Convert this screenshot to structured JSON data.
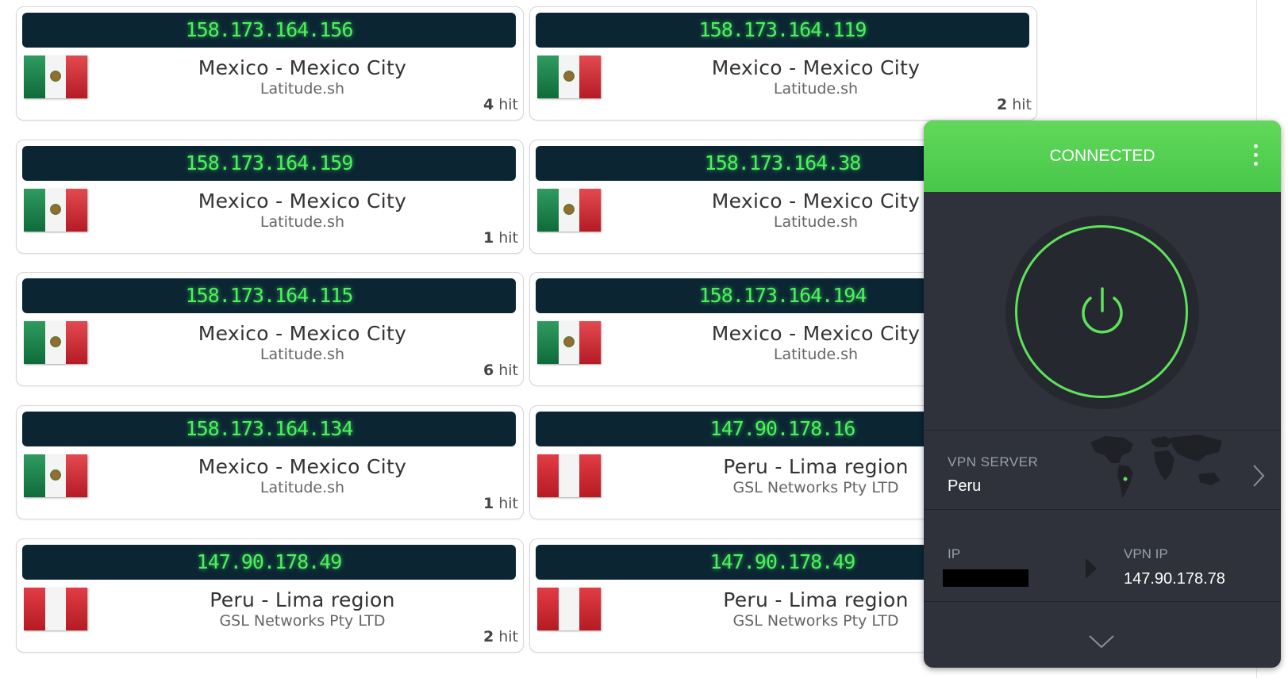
{
  "cards": [
    {
      "ip": "158.173.164.156",
      "location": "Mexico - Mexico City",
      "isp": "Latitude.sh",
      "hits": "4",
      "hit_word": "hit",
      "flag": "mexico-flag"
    },
    {
      "ip": "158.173.164.119",
      "location": "Mexico - Mexico City",
      "isp": "Latitude.sh",
      "hits": "2",
      "hit_word": "hit",
      "flag": "mexico-flag"
    },
    {
      "ip": "158.173.164.159",
      "location": "Mexico - Mexico City",
      "isp": "Latitude.sh",
      "hits": "1",
      "hit_word": "hit",
      "flag": "mexico-flag"
    },
    {
      "ip": "158.173.164.38",
      "location": "Mexico - Mexico City",
      "isp": "Latitude.sh",
      "flag": "mexico-flag"
    },
    {
      "ip": "158.173.164.115",
      "location": "Mexico - Mexico City",
      "isp": "Latitude.sh",
      "hits": "6",
      "hit_word": "hit",
      "flag": "mexico-flag"
    },
    {
      "ip": "158.173.164.194",
      "location": "Mexico - Mexico City",
      "isp": "Latitude.sh",
      "flag": "mexico-flag"
    },
    {
      "ip": "158.173.164.134",
      "location": "Mexico - Mexico City",
      "isp": "Latitude.sh",
      "hits": "1",
      "hit_word": "hit",
      "flag": "mexico-flag"
    },
    {
      "ip": "147.90.178.16",
      "location": "Peru - Lima region",
      "isp": "GSL Networks Pty LTD",
      "flag": "peru-flag"
    },
    {
      "ip": "147.90.178.49",
      "location": "Peru - Lima region",
      "isp": "GSL Networks Pty LTD",
      "hits": "2",
      "hit_word": "hit",
      "flag": "peru-flag"
    },
    {
      "ip": "147.90.178.49",
      "location": "Peru - Lima region",
      "isp": "GSL Networks Pty LTD",
      "flag": "peru-flag"
    }
  ],
  "vpn": {
    "status": "CONNECTED",
    "server_label": "VPN SERVER",
    "server_value": "Peru",
    "ip_label": "IP",
    "vpn_ip_label": "VPN IP",
    "vpn_ip_value": "147.90.178.78",
    "icons": [
      "kebab-menu-icon",
      "power-icon",
      "world-map-icon",
      "chevron-right-icon",
      "arrow-right-icon",
      "chevron-down-icon"
    ]
  },
  "colors": {
    "ip_bar_bg": "#0b2533",
    "ip_text": "#4cf25c",
    "vpn_green": "#52d152",
    "vpn_panel_bg": "#2f323a"
  }
}
